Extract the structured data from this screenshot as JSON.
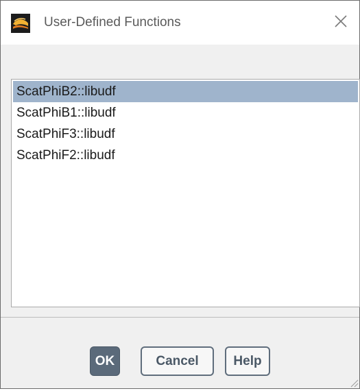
{
  "window": {
    "title": "User-Defined Functions",
    "icon": "fluent-app-icon",
    "close_icon": "close-icon"
  },
  "functions_list": {
    "items": [
      {
        "label": "ScatPhiB2::libudf",
        "selected": true
      },
      {
        "label": "ScatPhiB1::libudf",
        "selected": false
      },
      {
        "label": "ScatPhiF3::libudf",
        "selected": false
      },
      {
        "label": "ScatPhiF2::libudf",
        "selected": false
      }
    ],
    "selection_color": "#9fb4cc"
  },
  "buttons": {
    "ok_label": "OK",
    "cancel_label": "Cancel",
    "help_label": "Help"
  },
  "colors": {
    "body_background": "#f0f0f0",
    "primary_button": "#5b6a7a",
    "secondary_button_text": "#4a5866"
  }
}
